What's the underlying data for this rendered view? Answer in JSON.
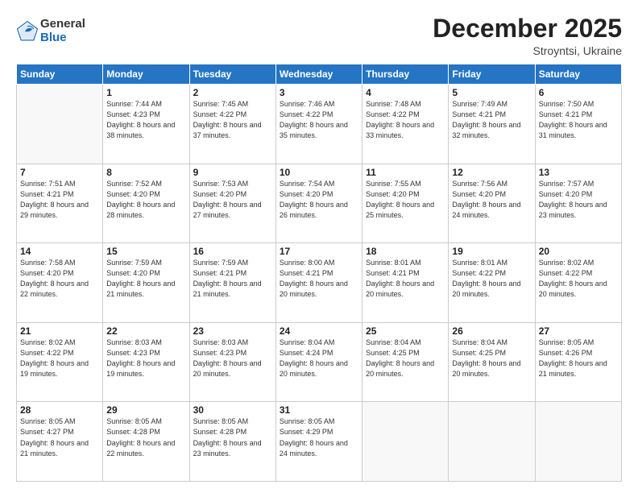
{
  "logo": {
    "general": "General",
    "blue": "Blue"
  },
  "header": {
    "month": "December 2025",
    "location": "Stroyntsi, Ukraine"
  },
  "weekdays": [
    "Sunday",
    "Monday",
    "Tuesday",
    "Wednesday",
    "Thursday",
    "Friday",
    "Saturday"
  ],
  "weeks": [
    [
      {
        "day": "",
        "empty": true
      },
      {
        "day": "1",
        "sunrise": "7:44 AM",
        "sunset": "4:23 PM",
        "daylight": "8 hours and 38 minutes."
      },
      {
        "day": "2",
        "sunrise": "7:45 AM",
        "sunset": "4:22 PM",
        "daylight": "8 hours and 37 minutes."
      },
      {
        "day": "3",
        "sunrise": "7:46 AM",
        "sunset": "4:22 PM",
        "daylight": "8 hours and 35 minutes."
      },
      {
        "day": "4",
        "sunrise": "7:48 AM",
        "sunset": "4:22 PM",
        "daylight": "8 hours and 33 minutes."
      },
      {
        "day": "5",
        "sunrise": "7:49 AM",
        "sunset": "4:21 PM",
        "daylight": "8 hours and 32 minutes."
      },
      {
        "day": "6",
        "sunrise": "7:50 AM",
        "sunset": "4:21 PM",
        "daylight": "8 hours and 31 minutes."
      }
    ],
    [
      {
        "day": "7",
        "sunrise": "7:51 AM",
        "sunset": "4:21 PM",
        "daylight": "8 hours and 29 minutes."
      },
      {
        "day": "8",
        "sunrise": "7:52 AM",
        "sunset": "4:20 PM",
        "daylight": "8 hours and 28 minutes."
      },
      {
        "day": "9",
        "sunrise": "7:53 AM",
        "sunset": "4:20 PM",
        "daylight": "8 hours and 27 minutes."
      },
      {
        "day": "10",
        "sunrise": "7:54 AM",
        "sunset": "4:20 PM",
        "daylight": "8 hours and 26 minutes."
      },
      {
        "day": "11",
        "sunrise": "7:55 AM",
        "sunset": "4:20 PM",
        "daylight": "8 hours and 25 minutes."
      },
      {
        "day": "12",
        "sunrise": "7:56 AM",
        "sunset": "4:20 PM",
        "daylight": "8 hours and 24 minutes."
      },
      {
        "day": "13",
        "sunrise": "7:57 AM",
        "sunset": "4:20 PM",
        "daylight": "8 hours and 23 minutes."
      }
    ],
    [
      {
        "day": "14",
        "sunrise": "7:58 AM",
        "sunset": "4:20 PM",
        "daylight": "8 hours and 22 minutes."
      },
      {
        "day": "15",
        "sunrise": "7:59 AM",
        "sunset": "4:20 PM",
        "daylight": "8 hours and 21 minutes."
      },
      {
        "day": "16",
        "sunrise": "7:59 AM",
        "sunset": "4:21 PM",
        "daylight": "8 hours and 21 minutes."
      },
      {
        "day": "17",
        "sunrise": "8:00 AM",
        "sunset": "4:21 PM",
        "daylight": "8 hours and 20 minutes."
      },
      {
        "day": "18",
        "sunrise": "8:01 AM",
        "sunset": "4:21 PM",
        "daylight": "8 hours and 20 minutes."
      },
      {
        "day": "19",
        "sunrise": "8:01 AM",
        "sunset": "4:22 PM",
        "daylight": "8 hours and 20 minutes."
      },
      {
        "day": "20",
        "sunrise": "8:02 AM",
        "sunset": "4:22 PM",
        "daylight": "8 hours and 20 minutes."
      }
    ],
    [
      {
        "day": "21",
        "sunrise": "8:02 AM",
        "sunset": "4:22 PM",
        "daylight": "8 hours and 19 minutes."
      },
      {
        "day": "22",
        "sunrise": "8:03 AM",
        "sunset": "4:23 PM",
        "daylight": "8 hours and 19 minutes."
      },
      {
        "day": "23",
        "sunrise": "8:03 AM",
        "sunset": "4:23 PM",
        "daylight": "8 hours and 20 minutes."
      },
      {
        "day": "24",
        "sunrise": "8:04 AM",
        "sunset": "4:24 PM",
        "daylight": "8 hours and 20 minutes."
      },
      {
        "day": "25",
        "sunrise": "8:04 AM",
        "sunset": "4:25 PM",
        "daylight": "8 hours and 20 minutes."
      },
      {
        "day": "26",
        "sunrise": "8:04 AM",
        "sunset": "4:25 PM",
        "daylight": "8 hours and 20 minutes."
      },
      {
        "day": "27",
        "sunrise": "8:05 AM",
        "sunset": "4:26 PM",
        "daylight": "8 hours and 21 minutes."
      }
    ],
    [
      {
        "day": "28",
        "sunrise": "8:05 AM",
        "sunset": "4:27 PM",
        "daylight": "8 hours and 21 minutes."
      },
      {
        "day": "29",
        "sunrise": "8:05 AM",
        "sunset": "4:28 PM",
        "daylight": "8 hours and 22 minutes."
      },
      {
        "day": "30",
        "sunrise": "8:05 AM",
        "sunset": "4:28 PM",
        "daylight": "8 hours and 23 minutes."
      },
      {
        "day": "31",
        "sunrise": "8:05 AM",
        "sunset": "4:29 PM",
        "daylight": "8 hours and 24 minutes."
      },
      {
        "day": "",
        "empty": true
      },
      {
        "day": "",
        "empty": true
      },
      {
        "day": "",
        "empty": true
      }
    ]
  ]
}
